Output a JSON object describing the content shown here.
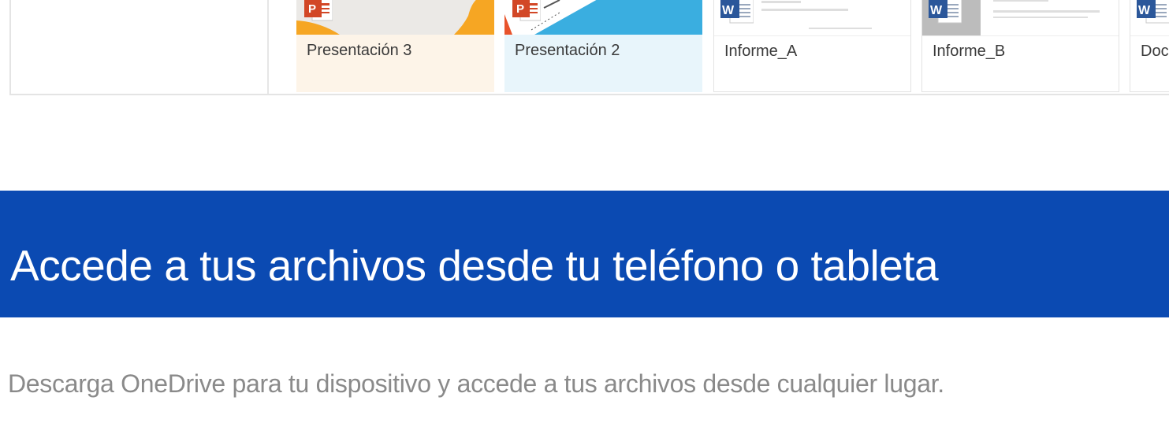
{
  "files": [
    {
      "name": "Presentación 3",
      "type": "powerpoint",
      "icon": "powerpoint-icon"
    },
    {
      "name": "Presentación 2",
      "type": "powerpoint",
      "icon": "powerpoint-icon"
    },
    {
      "name": "Informe_A",
      "type": "word",
      "icon": "word-icon"
    },
    {
      "name": "Informe_B",
      "type": "word",
      "icon": "word-icon"
    },
    {
      "name": "Doc",
      "type": "word",
      "icon": "word-icon"
    }
  ],
  "banner": {
    "title": "Accede a tus archivos desde tu teléfono o tableta"
  },
  "promo": {
    "text": "Descarga OneDrive para tu dispositivo y accede a tus archivos desde cualquier lugar."
  },
  "colors": {
    "banner_blue": "#0b4ab2",
    "powerpoint_orange": "#d24726",
    "word_blue": "#2b579a"
  }
}
